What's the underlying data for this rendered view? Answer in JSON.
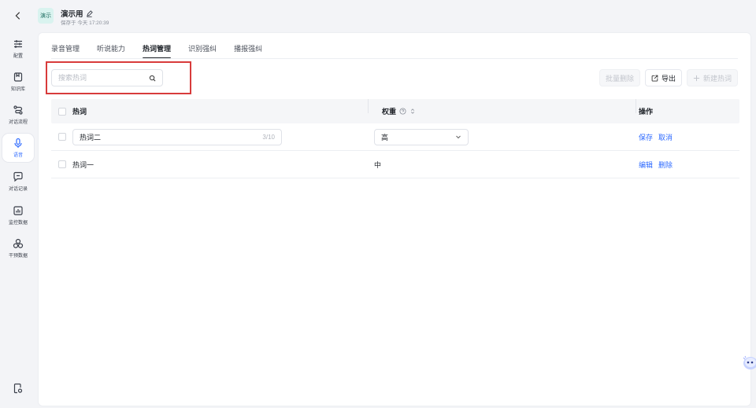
{
  "header": {
    "badge": "演示",
    "title": "演示用",
    "subtitle": "保存于 今天 17:20:39"
  },
  "nav": [
    {
      "key": "config",
      "label": "配置",
      "icon": "sliders-icon"
    },
    {
      "key": "kb",
      "label": "知识库",
      "icon": "book-icon"
    },
    {
      "key": "flow",
      "label": "对话流程",
      "icon": "flow-icon"
    },
    {
      "key": "voice",
      "label": "语音",
      "icon": "mic-icon",
      "active": true
    },
    {
      "key": "records",
      "label": "对话记录",
      "icon": "chat-icon"
    },
    {
      "key": "monitor",
      "label": "监控数据",
      "icon": "chart-icon"
    },
    {
      "key": "intervene",
      "label": "干预数据",
      "icon": "circles-icon"
    }
  ],
  "tabs": [
    "录音管理",
    "听说能力",
    "热词管理",
    "识别强纠",
    "播报强纠"
  ],
  "active_tab": "热词管理",
  "search": {
    "placeholder": "搜索热词",
    "value": ""
  },
  "toolbar": {
    "batch_delete": "批量删除",
    "export": "导出",
    "new": "新建热词"
  },
  "table": {
    "headers": {
      "word": "热词",
      "weight": "权重",
      "ops": "操作"
    },
    "rows": [
      {
        "word": "热词二",
        "count": "3/10",
        "weight": "高",
        "editing": true,
        "op1": "保存",
        "op2": "取消"
      },
      {
        "word": "热词一",
        "weight": "中",
        "editing": false,
        "op1": "编辑",
        "op2": "删除"
      }
    ]
  },
  "colors": {
    "accent": "#2f6bff",
    "highlight": "#d83b3b"
  }
}
